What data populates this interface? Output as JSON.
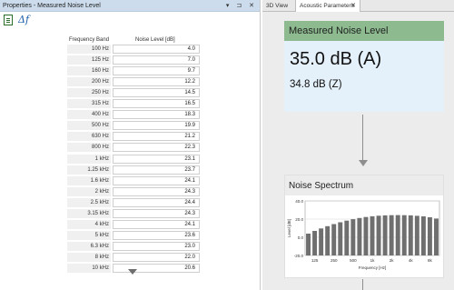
{
  "left_panel": {
    "title": "Properties - Measured Noise Level",
    "controls": "▾ ⊐ ✕",
    "toolbar": {
      "delta_label": "Δf",
      "doc_icon": "document-icon"
    },
    "columns": {
      "band": "Frequency Band",
      "noise": "Noise Level [dB]"
    },
    "rows": [
      {
        "band": "100 Hz",
        "value": "4.0"
      },
      {
        "band": "125 Hz",
        "value": "7.0"
      },
      {
        "band": "160 Hz",
        "value": "9.7"
      },
      {
        "band": "200 Hz",
        "value": "12.2"
      },
      {
        "band": "250 Hz",
        "value": "14.5"
      },
      {
        "band": "315 Hz",
        "value": "16.5"
      },
      {
        "band": "400 Hz",
        "value": "18.3"
      },
      {
        "band": "500 Hz",
        "value": "19.9"
      },
      {
        "band": "630 Hz",
        "value": "21.2"
      },
      {
        "band": "800 Hz",
        "value": "22.3"
      },
      {
        "band": "1 kHz",
        "value": "23.1"
      },
      {
        "band": "1.25 kHz",
        "value": "23.7"
      },
      {
        "band": "1.6 kHz",
        "value": "24.1"
      },
      {
        "band": "2 kHz",
        "value": "24.3"
      },
      {
        "band": "2.5 kHz",
        "value": "24.4"
      },
      {
        "band": "3.15 kHz",
        "value": "24.3"
      },
      {
        "band": "4 kHz",
        "value": "24.1"
      },
      {
        "band": "5 kHz",
        "value": "23.6"
      },
      {
        "band": "6.3 kHz",
        "value": "23.0"
      },
      {
        "band": "8 kHz",
        "value": "22.0"
      },
      {
        "band": "10 kHz",
        "value": "20.6"
      }
    ]
  },
  "tabs": [
    {
      "label": "3D View"
    },
    {
      "label": "Acoustic Parameters",
      "close": "✕"
    }
  ],
  "card_level": {
    "title": "Measured Noise Level",
    "value_a": "35.0  dB (A)",
    "value_z": "34.8  dB (Z)",
    "header_color": "#8dbb8f"
  },
  "card_spectrum": {
    "title": "Noise Spectrum"
  },
  "chart_data": {
    "type": "bar",
    "xlabel": "Frequency [Hz]",
    "ylabel": "Level [dB]",
    "ylim": [
      -20,
      40
    ],
    "yticks": [
      "40.0",
      "20.0",
      "0.0",
      "-20.0"
    ],
    "xticks": [
      "125",
      "250",
      "500",
      "1k",
      "2k",
      "4k",
      "8k"
    ],
    "categories": [
      "100 Hz",
      "125 Hz",
      "160 Hz",
      "200 Hz",
      "250 Hz",
      "315 Hz",
      "400 Hz",
      "500 Hz",
      "630 Hz",
      "800 Hz",
      "1 kHz",
      "1.25 kHz",
      "1.6 kHz",
      "2 kHz",
      "2.5 kHz",
      "3.15 kHz",
      "4 kHz",
      "5 kHz",
      "6.3 kHz",
      "8 kHz",
      "10 kHz"
    ],
    "values": [
      4.0,
      7.0,
      9.7,
      12.2,
      14.5,
      16.5,
      18.3,
      19.9,
      21.2,
      22.3,
      23.1,
      23.7,
      24.1,
      24.3,
      24.4,
      24.3,
      24.1,
      23.6,
      23.0,
      22.0,
      20.6
    ],
    "bar_color": "#6f6f6f",
    "grid": true
  }
}
